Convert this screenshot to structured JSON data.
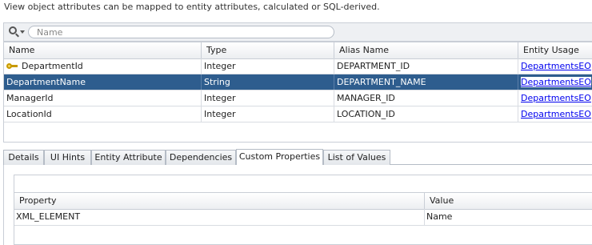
{
  "description": "View object attributes can be mapped to entity attributes, calculated or SQL-derived.",
  "search": {
    "placeholder": "Name"
  },
  "table": {
    "columns": [
      "Name",
      "Type",
      "Alias Name",
      "Entity Usage"
    ],
    "rows": [
      {
        "name": "DepartmentId",
        "type": "Integer",
        "alias": "DEPARTMENT_ID",
        "usage": "DepartmentsEO",
        "key": true
      },
      {
        "name": "DepartmentName",
        "type": "String",
        "alias": "DEPARTMENT_NAME",
        "usage": "DepartmentsEO",
        "selected": true
      },
      {
        "name": "ManagerId",
        "type": "Integer",
        "alias": "MANAGER_ID",
        "usage": "DepartmentsEO"
      },
      {
        "name": "LocationId",
        "type": "Integer",
        "alias": "LOCATION_ID",
        "usage": "DepartmentsEO"
      }
    ]
  },
  "tabs": [
    "Details",
    "UI Hints",
    "Entity Attribute",
    "Dependencies",
    "Custom Properties",
    "List of Values"
  ],
  "active_tab": "Custom Properties",
  "properties": {
    "columns": [
      "Property",
      "Value"
    ],
    "rows": [
      {
        "property": "XML_ELEMENT",
        "value": "Name"
      }
    ]
  },
  "colors": {
    "selection": "#2e5d8e",
    "link": "#0000ee"
  }
}
